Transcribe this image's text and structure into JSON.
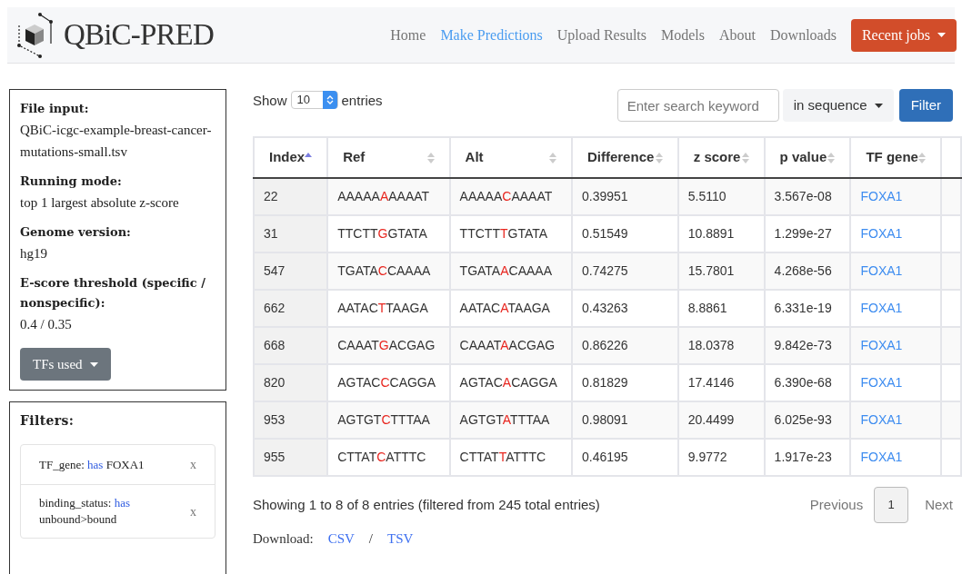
{
  "navbar": {
    "logo": "QBiC-PRED",
    "links": [
      {
        "label": "Home",
        "selected": false
      },
      {
        "label": "Make Predictions",
        "selected": true
      },
      {
        "label": "Upload Results",
        "selected": false
      },
      {
        "label": "Models",
        "selected": false
      },
      {
        "label": "About",
        "selected": false
      },
      {
        "label": "Downloads",
        "selected": false
      }
    ],
    "recent_jobs": "Recent jobs"
  },
  "job_info": {
    "fields": [
      {
        "label": "File input:",
        "value": "QBiC-icgc-example-breast-cancer-mutations-small.tsv"
      },
      {
        "label": "Running mode:",
        "value": "top 1 largest absolute z-score"
      },
      {
        "label": "Genome version:",
        "value": "hg19"
      },
      {
        "label": "E-score threshold (specific / nonspecific):",
        "value": "0.4 / 0.35"
      }
    ],
    "tfs_button": "TFs used"
  },
  "filters": {
    "title": "Filters:",
    "items": [
      {
        "field": "TF_gene:",
        "op": "has",
        "value": "FOXA1",
        "remove": "x"
      },
      {
        "field": "binding_status:",
        "op": "has",
        "value": "unbound>bound",
        "remove": "x"
      }
    ]
  },
  "table_controls": {
    "show": "Show",
    "page_size": "10",
    "entries": "entries",
    "search_placeholder": "Enter search keyword",
    "scope": "in sequence",
    "filter_button": "Filter"
  },
  "table": {
    "columns": [
      {
        "label": "Index",
        "sorted": true
      },
      {
        "label": "Ref",
        "sorted": false
      },
      {
        "label": "Alt",
        "sorted": false
      },
      {
        "label": "Difference",
        "sorted": false
      },
      {
        "label": "z score",
        "sorted": false
      },
      {
        "label": "p value",
        "sorted": false
      },
      {
        "label": "TF gene",
        "sorted": false
      }
    ],
    "rows": [
      {
        "index": "22",
        "ref": {
          "before": "AAAAA",
          "base": "A",
          "after": "AAAAT"
        },
        "alt": {
          "before": "AAAAA",
          "base": "C",
          "after": "AAAAT"
        },
        "difference": "0.39951",
        "z_score": "5.5110",
        "p_value": "3.567e-08",
        "tf_gene": "FOXA1"
      },
      {
        "index": "31",
        "ref": {
          "before": "TTCTT",
          "base": "G",
          "after": "GTATA"
        },
        "alt": {
          "before": "TTCTT",
          "base": "T",
          "after": "GTATA"
        },
        "difference": "0.51549",
        "z_score": "10.8891",
        "p_value": "1.299e-27",
        "tf_gene": "FOXA1"
      },
      {
        "index": "547",
        "ref": {
          "before": "TGATA",
          "base": "C",
          "after": "CAAAA"
        },
        "alt": {
          "before": "TGATA",
          "base": "A",
          "after": "CAAAA"
        },
        "difference": "0.74275",
        "z_score": "15.7801",
        "p_value": "4.268e-56",
        "tf_gene": "FOXA1"
      },
      {
        "index": "662",
        "ref": {
          "before": "AATAC",
          "base": "T",
          "after": "TAAGA"
        },
        "alt": {
          "before": "AATAC",
          "base": "A",
          "after": "TAAGA"
        },
        "difference": "0.43263",
        "z_score": "8.8861",
        "p_value": "6.331e-19",
        "tf_gene": "FOXA1"
      },
      {
        "index": "668",
        "ref": {
          "before": "CAAAT",
          "base": "G",
          "after": "ACGAG"
        },
        "alt": {
          "before": "CAAAT",
          "base": "A",
          "after": "ACGAG"
        },
        "difference": "0.86226",
        "z_score": "18.0378",
        "p_value": "9.842e-73",
        "tf_gene": "FOXA1"
      },
      {
        "index": "820",
        "ref": {
          "before": "AGTAC",
          "base": "C",
          "after": "CAGGA"
        },
        "alt": {
          "before": "AGTAC",
          "base": "A",
          "after": "CAGGA"
        },
        "difference": "0.81829",
        "z_score": "17.4146",
        "p_value": "6.390e-68",
        "tf_gene": "FOXA1"
      },
      {
        "index": "953",
        "ref": {
          "before": "AGTGT",
          "base": "C",
          "after": "TTTAA"
        },
        "alt": {
          "before": "AGTGT",
          "base": "A",
          "after": "TTTAA"
        },
        "difference": "0.98091",
        "z_score": "20.4499",
        "p_value": "6.025e-93",
        "tf_gene": "FOXA1"
      },
      {
        "index": "955",
        "ref": {
          "before": "CTTAT",
          "base": "C",
          "after": "ATTTC"
        },
        "alt": {
          "before": "CTTAT",
          "base": "T",
          "after": "ATTTC"
        },
        "difference": "0.46195",
        "z_score": "9.9772",
        "p_value": "1.917e-23",
        "tf_gene": "FOXA1"
      }
    ]
  },
  "table_info": "Showing 1 to 8 of 8 entries (filtered from 245 total entries)",
  "pagination": {
    "previous": "Previous",
    "pages": [
      {
        "label": "1",
        "selected": true
      }
    ],
    "next": "Next"
  },
  "download": {
    "label": "Download:",
    "links": [
      "CSV",
      "TSV"
    ],
    "separator": "/"
  }
}
